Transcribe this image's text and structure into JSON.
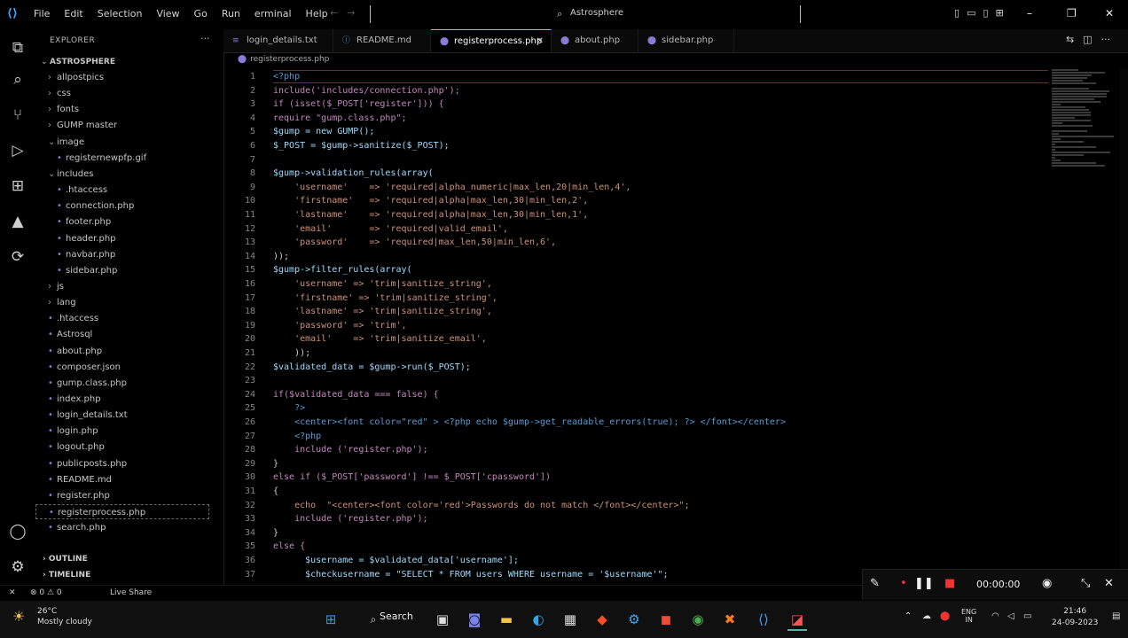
{
  "titlebar": {
    "menu": [
      "File",
      "Edit",
      "Selection",
      "View",
      "Go",
      "Run",
      "erminal",
      "Help"
    ],
    "search_text": "Astrosphere",
    "window_controls": [
      "–",
      "❐",
      "✕"
    ]
  },
  "explorer": {
    "title": "EXPLORER",
    "more": "···",
    "root": "ASTROSPHERE",
    "items": [
      {
        "label": "allpostpics",
        "type": "folder",
        "depth": 1,
        "open": false
      },
      {
        "label": "css",
        "type": "folder",
        "depth": 1,
        "open": false
      },
      {
        "label": "fonts",
        "type": "folder",
        "depth": 1,
        "open": false
      },
      {
        "label": "GUMP master",
        "type": "folder",
        "depth": 1,
        "open": false
      },
      {
        "label": "image",
        "type": "folder",
        "depth": 1,
        "open": true
      },
      {
        "label": "registernewpfp.gif",
        "type": "file",
        "depth": 2
      },
      {
        "label": "includes",
        "type": "folder",
        "depth": 1,
        "open": true
      },
      {
        "label": ".htaccess",
        "type": "file",
        "depth": 2
      },
      {
        "label": "connection.php",
        "type": "file",
        "depth": 2
      },
      {
        "label": "footer.php",
        "type": "file",
        "depth": 2
      },
      {
        "label": "header.php",
        "type": "file",
        "depth": 2
      },
      {
        "label": "navbar.php",
        "type": "file",
        "depth": 2
      },
      {
        "label": "sidebar.php",
        "type": "file",
        "depth": 2
      },
      {
        "label": "js",
        "type": "folder",
        "depth": 1,
        "open": false
      },
      {
        "label": "lang",
        "type": "folder",
        "depth": 1,
        "open": false
      },
      {
        "label": ".htaccess",
        "type": "file",
        "depth": 1
      },
      {
        "label": "Astrosql",
        "type": "file",
        "depth": 1
      },
      {
        "label": "about.php",
        "type": "file",
        "depth": 1
      },
      {
        "label": "composer.json",
        "type": "file",
        "depth": 1
      },
      {
        "label": "gump.class.php",
        "type": "file",
        "depth": 1
      },
      {
        "label": "index.php",
        "type": "file",
        "depth": 1
      },
      {
        "label": "login_details.txt",
        "type": "file",
        "depth": 1
      },
      {
        "label": "login.php",
        "type": "file",
        "depth": 1
      },
      {
        "label": "logout.php",
        "type": "file",
        "depth": 1
      },
      {
        "label": "publicposts.php",
        "type": "file",
        "depth": 1
      },
      {
        "label": "README.md",
        "type": "file",
        "depth": 1
      },
      {
        "label": "register.php",
        "type": "file",
        "depth": 1
      },
      {
        "label": "registerprocess.php",
        "type": "file",
        "depth": 1,
        "selected": true
      },
      {
        "label": "search.php",
        "type": "file",
        "depth": 1
      }
    ],
    "sections": [
      "OUTLINE",
      "TIMELINE"
    ]
  },
  "tabs": [
    {
      "label": "login_details.txt",
      "active": false
    },
    {
      "label": "README.md",
      "active": false
    },
    {
      "label": "registerprocess.php",
      "active": true
    },
    {
      "label": "about.php",
      "active": false
    },
    {
      "label": "sidebar.php",
      "active": false
    }
  ],
  "breadcrumb": "registerprocess.php",
  "code_lines": [
    {
      "n": "1",
      "t": "<?php"
    },
    {
      "n": "2",
      "t": "include('includes/connection.php');"
    },
    {
      "n": "3",
      "t": "if (isset($_POST['register'])) {"
    },
    {
      "n": "4",
      "t": "require \"gump.class.php\";"
    },
    {
      "n": "5",
      "t": "$gump = new GUMP();"
    },
    {
      "n": "6",
      "t": "$_POST = $gump->sanitize($_POST);"
    },
    {
      "n": "7",
      "t": ""
    },
    {
      "n": "8",
      "t": "$gump->validation_rules(array("
    },
    {
      "n": "9",
      "t": "    'username'    => 'required|alpha_numeric|max_len,20|min_len,4',"
    },
    {
      "n": "10",
      "t": "    'firstname'   => 'required|alpha|max_len,30|min_len,2',"
    },
    {
      "n": "11",
      "t": "    'lastname'    => 'required|alpha|max_len,30|min_len,1',"
    },
    {
      "n": "12",
      "t": "    'email'       => 'required|valid_email',"
    },
    {
      "n": "13",
      "t": "    'password'    => 'required|max_len,50|min_len,6',"
    },
    {
      "n": "14",
      "t": "));"
    },
    {
      "n": "15",
      "t": "$gump->filter_rules(array("
    },
    {
      "n": "16",
      "t": "    'username' => 'trim|sanitize_string',"
    },
    {
      "n": "17",
      "t": "    'firstname' => 'trim|sanitize_string',"
    },
    {
      "n": "18",
      "t": "    'lastname' => 'trim|sanitize_string',"
    },
    {
      "n": "19",
      "t": "    'password' => 'trim',"
    },
    {
      "n": "20",
      "t": "    'email'    => 'trim|sanitize_email',"
    },
    {
      "n": "21",
      "t": "    ));"
    },
    {
      "n": "22",
      "t": "$validated_data = $gump->run($_POST);"
    },
    {
      "n": "23",
      "t": ""
    },
    {
      "n": "24",
      "t": "if($validated_data === false) {"
    },
    {
      "n": "25",
      "t": "    ?>"
    },
    {
      "n": "26",
      "t": "    <center><font color=\"red\" > <?php echo $gump->get_readable_errors(true); ?> </font></center>"
    },
    {
      "n": "27",
      "t": "    <?php"
    },
    {
      "n": "28",
      "t": "    include ('register.php');"
    },
    {
      "n": "29",
      "t": "}"
    },
    {
      "n": "30",
      "t": "else if ($_POST['password'] !== $_POST['cpassword'])"
    },
    {
      "n": "31",
      "t": "{"
    },
    {
      "n": "32",
      "t": "    echo  \"<center><font color='red'>Passwords do not match </font></center>\";"
    },
    {
      "n": "33",
      "t": "    include ('register.php');"
    },
    {
      "n": "34",
      "t": "}"
    },
    {
      "n": "35",
      "t": "else {"
    },
    {
      "n": "36",
      "t": "      $username = $validated_data['username'];"
    },
    {
      "n": "37",
      "t": "      $checkusername = \"SELECT * FROM users WHERE username = '$username'\";"
    }
  ],
  "statusbar": {
    "left": [
      "✕",
      "⊗ 0 ⚠ 0",
      "Live Share"
    ]
  },
  "recorder": {
    "time": "00:00:00"
  },
  "taskbar": {
    "temp": "26°C",
    "weather": "Mostly cloudy",
    "search": "Search",
    "lang_top": "ENG",
    "lang_bottom": "IN",
    "time": "21:46",
    "date": "24-09-2023"
  }
}
